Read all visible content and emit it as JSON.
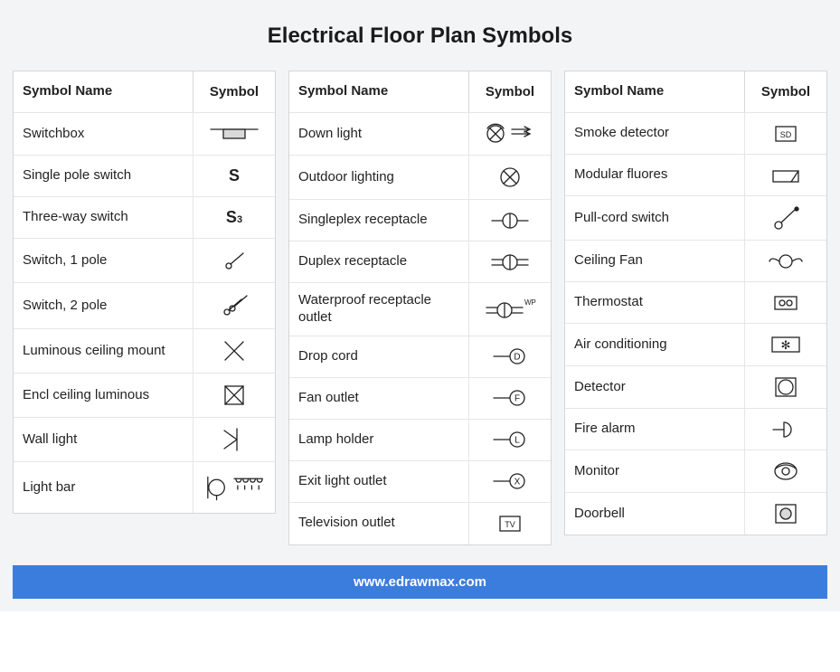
{
  "title": "Electrical Floor Plan Symbols",
  "columns": {
    "name_header": "Symbol Name",
    "symbol_header": "Symbol"
  },
  "tables": [
    {
      "rows": [
        {
          "name": "Switchbox",
          "symbol": "switchbox"
        },
        {
          "name": "Single pole switch",
          "symbol": "s"
        },
        {
          "name": "Three-way switch",
          "symbol": "s3"
        },
        {
          "name": "Switch, 1 pole",
          "symbol": "switch1p"
        },
        {
          "name": "Switch, 2 pole",
          "symbol": "switch2p"
        },
        {
          "name": "Luminous ceiling mount",
          "symbol": "xmark"
        },
        {
          "name": "Encl ceiling luminous",
          "symbol": "boxedx"
        },
        {
          "name": "Wall light",
          "symbol": "walllight"
        },
        {
          "name": "Light bar",
          "symbol": "lightbar"
        }
      ]
    },
    {
      "rows": [
        {
          "name": "Down light",
          "symbol": "downlight"
        },
        {
          "name": "Outdoor lighting",
          "symbol": "circlex"
        },
        {
          "name": "Singleplex receptacle",
          "symbol": "recept1"
        },
        {
          "name": "Duplex receptacle",
          "symbol": "recept2"
        },
        {
          "name": "Waterproof receptacle outlet",
          "symbol": "receptwp"
        },
        {
          "name": "Drop cord",
          "symbol": "letD"
        },
        {
          "name": "Fan outlet",
          "symbol": "letF"
        },
        {
          "name": "Lamp holder",
          "symbol": "letL"
        },
        {
          "name": "Exit light outlet",
          "symbol": "letX"
        },
        {
          "name": "Television outlet",
          "symbol": "tv"
        }
      ]
    },
    {
      "rows": [
        {
          "name": "Smoke detector",
          "symbol": "sd"
        },
        {
          "name": "Modular fluores",
          "symbol": "modfluor"
        },
        {
          "name": "Pull-cord switch",
          "symbol": "pullcord"
        },
        {
          "name": "Ceiling Fan",
          "symbol": "ceilfan"
        },
        {
          "name": "Thermostat",
          "symbol": "thermo"
        },
        {
          "name": "Air conditioning",
          "symbol": "ac"
        },
        {
          "name": "Detector",
          "symbol": "detector"
        },
        {
          "name": "Fire alarm",
          "symbol": "firealarm"
        },
        {
          "name": "Monitor",
          "symbol": "monitor"
        },
        {
          "name": "Doorbell",
          "symbol": "doorbell"
        }
      ]
    }
  ],
  "footer": "www.edrawmax.com"
}
